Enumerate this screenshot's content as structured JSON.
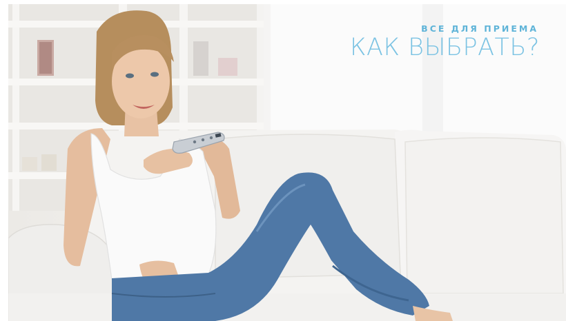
{
  "headline": {
    "kicker": "ВСЕ ДЛЯ ПРИЕМА",
    "title": "КАК ВЫБРАТЬ?"
  },
  "photo": {
    "subject": "woman on white sofa holding TV remote",
    "accent_color": "#7cc3e3"
  }
}
